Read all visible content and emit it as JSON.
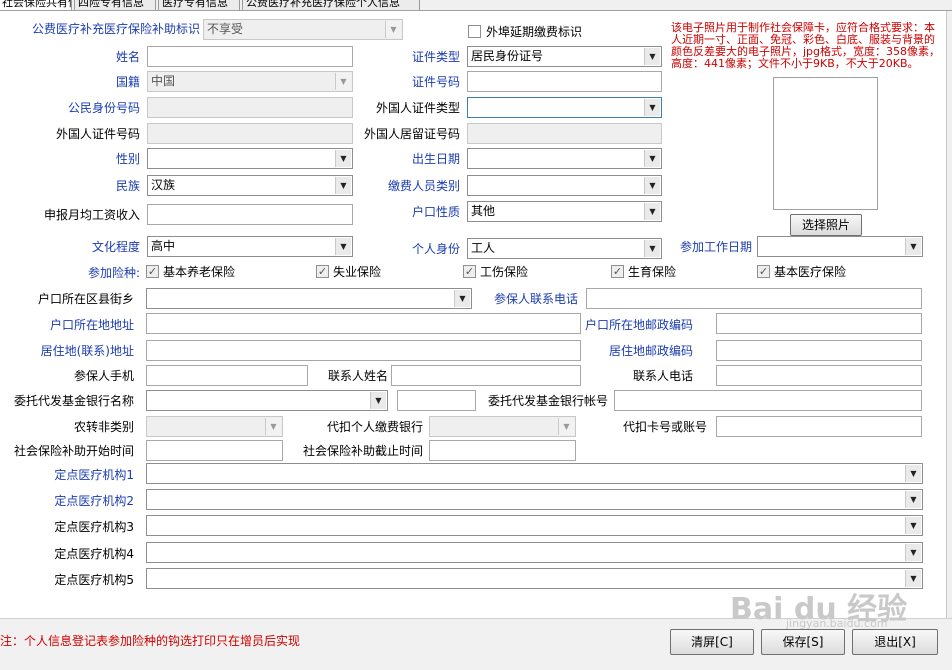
{
  "tabs": [
    "社会保险共有信息",
    "四险专有信息",
    "医疗专有信息",
    "公费医疗补充医疗保险个人信息"
  ],
  "header": {
    "subsidy_label": "公费医疗补充医疗保险补助标识",
    "subsidy_value": "不享受",
    "out_of_town_label": "外埠延期缴费标识"
  },
  "photo_note": "该电子照片用于制作社会保障卡，应符合格式要求：本人近期一寸、正面、免冠、彩色、白底、服装与背景的颜色反差要大的电子照片，jpg格式，宽度：358像素，高度：441像素；文件不小于9KB，不大于20KB。",
  "photo_button": "选择照片",
  "fields": {
    "name": {
      "label": "姓名",
      "value": ""
    },
    "id_type": {
      "label": "证件类型",
      "value": "居民身份证号"
    },
    "nationality": {
      "label": "国籍",
      "value": "中国"
    },
    "id_number": {
      "label": "证件号码",
      "value": ""
    },
    "citizen_id": {
      "label": "公民身份号码",
      "value": ""
    },
    "foreign_id_type": {
      "label": "外国人证件类型",
      "value": ""
    },
    "foreign_id_number": {
      "label": "外国人证件号码",
      "value": ""
    },
    "foreign_residence_no": {
      "label": "外国人居留证号码",
      "value": ""
    },
    "gender": {
      "label": "性别",
      "value": ""
    },
    "birth_date": {
      "label": "出生日期",
      "value": ""
    },
    "ethnicity": {
      "label": "民族",
      "value": "汉族"
    },
    "payer_category": {
      "label": "缴费人员类别",
      "value": ""
    },
    "monthly_wage": {
      "label": "申报月均工资收入",
      "value": ""
    },
    "hukou_type": {
      "label": "户口性质",
      "value": "其他"
    },
    "education": {
      "label": "文化程度",
      "value": "高中"
    },
    "personal_status": {
      "label": "个人身份",
      "value": "工人"
    },
    "work_start_date": {
      "label": "参加工作日期",
      "value": ""
    },
    "hukou_district": {
      "label": "户口所在区县街乡",
      "value": ""
    },
    "insured_phone": {
      "label": "参保人联系电话",
      "value": ""
    },
    "hukou_address": {
      "label": "户口所在地地址",
      "value": ""
    },
    "hukou_postcode": {
      "label": "户口所在地邮政编码",
      "value": ""
    },
    "residence_address": {
      "label": "居住地(联系)地址",
      "value": ""
    },
    "residence_postcode": {
      "label": "居住地邮政编码",
      "value": ""
    },
    "insured_mobile": {
      "label": "参保人手机",
      "value": ""
    },
    "contact_name": {
      "label": "联系人姓名",
      "value": ""
    },
    "contact_phone": {
      "label": "联系人电话",
      "value": ""
    },
    "bank_name": {
      "label": "委托代发基金银行名称",
      "value": ""
    },
    "bank_account": {
      "label": "委托代发基金银行帐号",
      "value": ""
    },
    "agri_category": {
      "label": "农转非类别",
      "value": ""
    },
    "deduct_bank": {
      "label": "代扣个人缴费银行",
      "value": ""
    },
    "deduct_account": {
      "label": "代扣卡号或账号",
      "value": ""
    },
    "subsidy_start": {
      "label": "社会保险补助开始时间",
      "value": ""
    },
    "subsidy_end": {
      "label": "社会保险补助截止时间",
      "value": ""
    }
  },
  "insurance": {
    "label": "参加险种:",
    "items": [
      "基本养老保险",
      "失业保险",
      "工伤保险",
      "生育保险",
      "基本医疗保险"
    ]
  },
  "medical": {
    "labels": [
      "定点医疗机构1",
      "定点医疗机构2",
      "定点医疗机构3",
      "定点医疗机构4",
      "定点医疗机构5"
    ]
  },
  "footer": {
    "note": "注：个人信息登记表参加险种的钩选打印只在增员后实现",
    "clear": "清屏[C]",
    "save": "保存[S]",
    "exit": "退出[X]"
  },
  "watermark": {
    "logo": "Bai du 经验",
    "url": "jingyan.baidu.com"
  },
  "icons": {
    "dropdown": "chevron-down-icon",
    "checkbox": "check-icon"
  },
  "colors": {
    "label_blue": "#1a3cb0",
    "note_red": "#d00000"
  }
}
